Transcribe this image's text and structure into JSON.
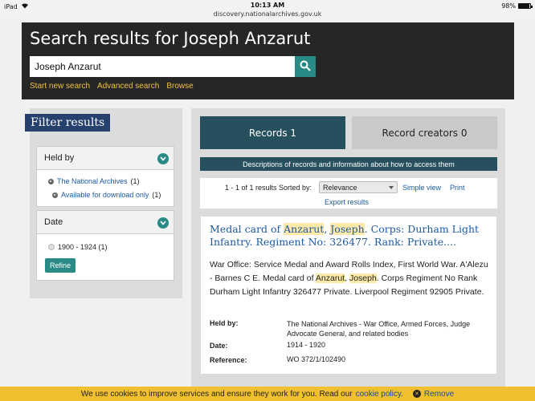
{
  "status_bar": {
    "device": "iPad",
    "time": "10:13 AM",
    "url": "discovery.nationalarchives.gov.uk",
    "battery": "98%"
  },
  "header": {
    "title": "Search results for Joseph Anzarut",
    "search_value": "Joseph Anzarut",
    "links": [
      "Start new search",
      "Advanced search",
      "Browse"
    ]
  },
  "filters": {
    "title": "Filter results",
    "held_by": {
      "label": "Held by",
      "items": [
        {
          "label": "The National Archives",
          "count": "(1)"
        },
        {
          "label": "Available for download only",
          "count": "(1)"
        }
      ]
    },
    "date": {
      "label": "Date",
      "option": "1900 - 1924 (1)",
      "refine_label": "Refine"
    }
  },
  "tabs": {
    "records": "Records 1",
    "record_creators": "Record creators 0"
  },
  "description_bar": "Descriptions of records and information about how to access them",
  "sort": {
    "count_text": "1 - 1 of 1 results Sorted by:",
    "selected": "Relevance",
    "simple_view": "Simple view",
    "print": "Print",
    "export": "Export results"
  },
  "result": {
    "title_parts": [
      "Medal card of ",
      "Anzarut",
      ", ",
      "Joseph",
      ". Corps: Durham Light Infantry. Regiment No: 326477. Rank: Private...."
    ],
    "desc_parts": [
      "War Office: Service Medal and Award Rolls Index, First World War. A'Alezu - Barnes C E. Medal card of ",
      "Anzarut",
      ", ",
      "Joseph",
      ". Corps Regiment No Rank Durham Light Infantry 326477 Private. Liverpool Regiment 92905 Private."
    ],
    "held_by_label": "Held by:",
    "held_by_value": "The National Archives - War Office, Armed Forces, Judge Advocate General, and related bodies",
    "date_label": "Date:",
    "date_value": "1914 - 1920",
    "reference_label": "Reference:",
    "reference_value": "WO 372/1/102490"
  },
  "cookie": {
    "text": "We use cookies to improve services and ensure they work for you. Read our",
    "policy_link": "cookie policy.",
    "remove": "Remove"
  },
  "colors": {
    "header_bg": "#262626",
    "accent_teal": "#2a8a86",
    "navy": "#26416e",
    "tab_active": "#26505e",
    "link_blue": "#1e5aa0",
    "cookie_yellow": "#f0c030",
    "highlight": "#fde9a8"
  }
}
